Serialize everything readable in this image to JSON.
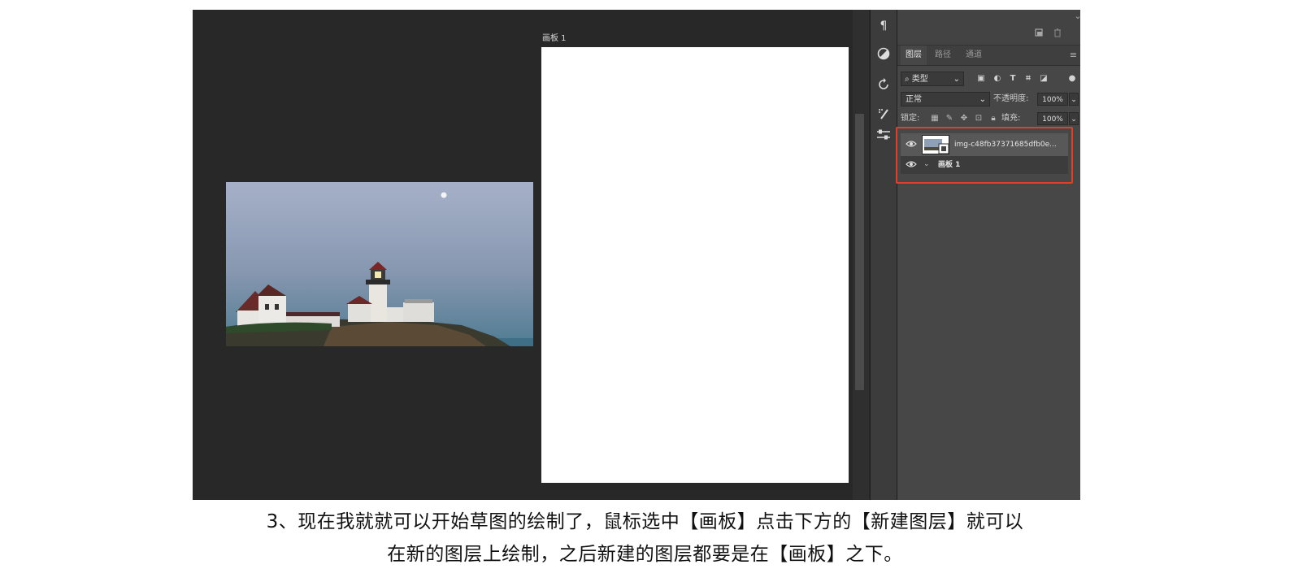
{
  "canvas": {
    "artboard_title": "画板 1"
  },
  "tools": {
    "paragraph_glyph": "¶"
  },
  "layers_panel": {
    "tabs": [
      {
        "label": "图层",
        "active": true
      },
      {
        "label": "路径",
        "active": false
      },
      {
        "label": "通道",
        "active": false
      }
    ],
    "filter": {
      "kind_label": "类型"
    },
    "blend_mode": "正常",
    "opacity_label": "不透明度:",
    "opacity_value": "100%",
    "lock_label": "锁定:",
    "fill_label": "填充:",
    "fill_value": "100%",
    "layers": [
      {
        "name": "img-c48fb37371685dfb0e...",
        "selected": true
      },
      {
        "name": "画板 1",
        "selected": false
      }
    ],
    "highlight_color": "#e0402a"
  },
  "caption": {
    "line1": "3、现在我就就可以开始草图的绘制了，鼠标选中【画板】点击下方的【新建图层】就可以",
    "line2": "在新的图层上绘制，之后新建的图层都要是在【画板】之下。"
  }
}
